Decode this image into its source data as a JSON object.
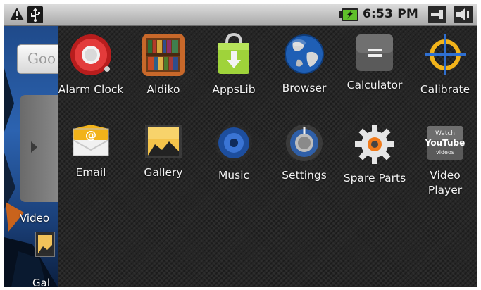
{
  "status_bar": {
    "time": "6:53 PM",
    "icons": [
      "warning-icon",
      "usb-icon",
      "battery-charging-icon",
      "navigation-back-icon",
      "volume-icon"
    ]
  },
  "home": {
    "search_widget_text": "Goo",
    "shortcut_labels": [
      "Video",
      "Gal"
    ]
  },
  "apps": [
    {
      "label": "Alarm Clock",
      "icon": "alarm-clock-icon"
    },
    {
      "label": "Aldiko",
      "icon": "aldiko-bookshelf-icon"
    },
    {
      "label": "AppsLib",
      "icon": "appslib-bag-icon"
    },
    {
      "label": "Browser",
      "icon": "globe-icon"
    },
    {
      "label": "Calculator",
      "icon": "calculator-icon"
    },
    {
      "label": "Calibrate",
      "icon": "crosshair-icon"
    },
    {
      "label": "Email",
      "icon": "email-envelope-icon"
    },
    {
      "label": "Gallery",
      "icon": "gallery-picture-icon"
    },
    {
      "label": "Music",
      "icon": "music-speaker-icon"
    },
    {
      "label": "Settings",
      "icon": "settings-dial-icon"
    },
    {
      "label": "Spare Parts",
      "icon": "spare-parts-gear-icon"
    },
    {
      "label": "Video\nPlayer",
      "icon": "youtube-icon"
    }
  ],
  "youtube_icon_text": {
    "top": "Watch",
    "brand": "YouTube",
    "bottom": "videos"
  }
}
